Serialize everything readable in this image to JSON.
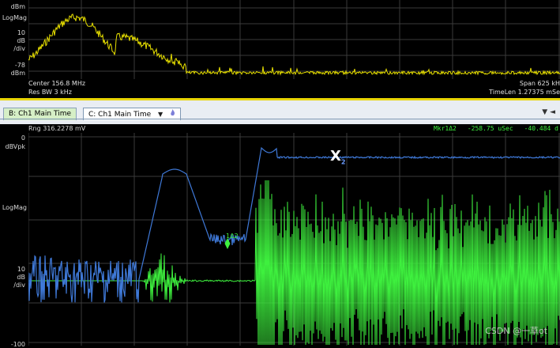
{
  "top_panel": {
    "y_labels": {
      "top": "dBm",
      "mid_label": "LogMag",
      "scale_num": "10",
      "scale_unit": "dB",
      "scale_div": "/div",
      "bottom_val": "-78",
      "bottom_unit": "dBm"
    },
    "info": {
      "center": "Center 156.8 MHz",
      "rbw": "Res BW 3 kHz",
      "span": "Span 625 kH",
      "timelen": "TimeLen 1.27375 mSe"
    },
    "trace_color": "#e8e000"
  },
  "tabs": [
    {
      "label": "B: Ch1 Main Time"
    },
    {
      "label": "C: Ch1 Main Time"
    }
  ],
  "tab_icons": {
    "dropdown": "▼",
    "flame": "🜂"
  },
  "strip_tools": "▼ ◄",
  "bottom_panel": {
    "rng": "Rng 316.2278 mV",
    "marker_readout": {
      "name": "Mkr1Δ2",
      "time": "-258.75 uSec",
      "value": "-40.484 d"
    },
    "y_labels": {
      "top_val": "0",
      "top_unit": "dBVpk",
      "mid_label": "LogMag",
      "scale_num": "10",
      "scale_unit": "dB",
      "scale_div": "/div",
      "bottom_val": "-100"
    },
    "marker_x": "X",
    "marker_x_sub": "2",
    "marker_delta": "1Δ2",
    "colors": {
      "blue_trace": "#3f79d8",
      "green_trace": "#3ef03e"
    }
  },
  "watermark": "CSDN @一草ot"
}
